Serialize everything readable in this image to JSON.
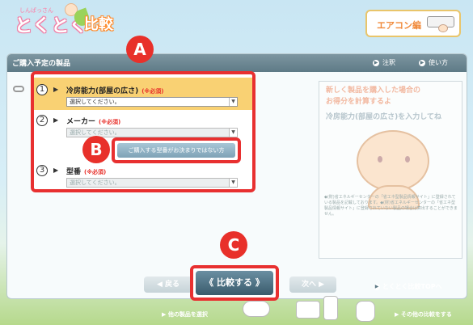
{
  "header": {
    "logo_small": "しんぱっさん",
    "logo_main": "とくとく",
    "logo_badge": "比較",
    "aircon_label": "エアコン編"
  },
  "panel": {
    "title": "ご購入予定の製品",
    "caution_link": "注釈",
    "howto_link": "使い方"
  },
  "form": {
    "rows": [
      {
        "num": "1",
        "label": "冷房能力(部屋の広さ)",
        "req": "(※必須)",
        "select": "選択してください。"
      },
      {
        "num": "2",
        "label": "メーカー",
        "req": "(※必須)",
        "select": "選択してください。"
      },
      {
        "num": "3",
        "label": "型番",
        "req": "(※必須)",
        "select": "選択してください。"
      }
    ],
    "unsure_button": "ご購入する型番がお決まりではない方"
  },
  "info": {
    "headline_1": "新しく製品を購入した場合の",
    "headline_2": "お得分を計算するよ",
    "instruction": "冷房能力(部屋の広さ)を入力してね",
    "note": "◆(財)省エネルギーセンターの「省エネ型製品情報サイト」に登録されている製品を記載しております。◆(財)省エネルギーセンターの「省エネ型製品情報サイト」に登録されていない製品の場合は算出することができません。"
  },
  "nav": {
    "back": "戻る",
    "compare": "比較する",
    "next": "次へ",
    "top_link": "とくとく比較TOPへ"
  },
  "markers": {
    "a": "A",
    "b": "B",
    "c": "C"
  },
  "footer": {
    "left": "▶ 他の製品を選択",
    "right": "▶ その他の比較をする"
  },
  "colors": {
    "accent_red": "#e8302a",
    "active_row": "#f9d173",
    "header_bar": "#6d8894"
  }
}
